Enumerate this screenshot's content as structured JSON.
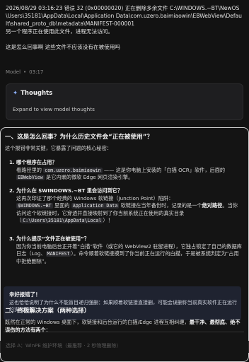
{
  "user_message": {
    "line1": "2026/08/29 03:16:23 错误 32 (0x00000020) 正在删除多余文件 C:\\WINDOWS.~BT\\NewOS\\Users\\35181\\AppData\\Local\\Application Data\\com.uzero.baimiaowin\\EBWebView\\Default\\shared_proto_db\\metadata\\MANIFEST-000001",
    "line2": "另一个程序正在使用此文件，进程无法访问。",
    "line3": "这是怎么回事啊 这些文件不应该没有在被使用吗"
  },
  "meta": {
    "author": "Model",
    "time": "03:17"
  },
  "thoughts": {
    "title": "Thoughts",
    "expand_label": "Expand to view model thoughts"
  },
  "answer": {
    "section1_title": "一、这是怎么回事？为什么历史文件会“正在被使用”？",
    "section1_intro": "这个报错非常关键，它暴露了问题的核心秘密：",
    "item1": {
      "num": "1.",
      "title": "哪个程序在占用？",
      "body_a": "看路径里的 ",
      "code1": "com.uzero.baimiaowin",
      "body_b": " —— 这是你电脑上安装的「白描 OCR」软件，后面的 ",
      "code2": "EBWebView",
      "body_c": " 是它内嵌的微软 Edge 网页渲染引擎。"
    },
    "item2": {
      "num": "2.",
      "title": "为什么在 $WINDOWS.~BT 里会访问到它？",
      "body_a": "这再次印证了那个经典的 Windows 软链接（Junction Point）陷阱：",
      "code1": "$WINDOWS.~BT",
      "body_b": " 里面的 ",
      "code2": "Application Data",
      "body_c": " 软链接在当年备份时，记录的是一个",
      "bold1": "绝对路径",
      "body_d": "。当你访问这个软链接时，它穿透并直接映射到了你当前系统正在使用的真实目录（",
      "code3": "C:\\Users\\35181\\AppData\\Local",
      "body_e": "）！"
    },
    "item3": {
      "num": "3.",
      "title": "为什么提示“文件正在被使用”？",
      "body_a": "因为你当前电脑后台正开着“白描”软件（或它的 WebView2 驻留进程），它独占锁定了自己的数据库日志（Log、",
      "code1": "MANIFEST",
      "body_b": "）。命令顺着软链接摸到了你当前正在运行的白描，于是被系统判定为“占用中拒绝删除”。"
    },
    "callout_title": "幸好报错了！",
    "callout_body": "这也恰恰说明了为什么不能盲目递归强删：如果顺着软链接直接删，可能会误删你当前真实软件正在运行的实时配置。",
    "section2_title": "二、终极解决方案（两种选择）",
    "section2_intro_a": "既然在正常的 Windows 桌面下，软链接和后台运行的白描/Edge 进程互相纠缠，",
    "section2_intro_bold": "最干净、最彻底、绝不误伤的方法有两个",
    "section2_intro_b": "：",
    "footer_fragment": "选择 A：WinPE 维护环境（最推荐 · 2 秒物理删除）"
  }
}
